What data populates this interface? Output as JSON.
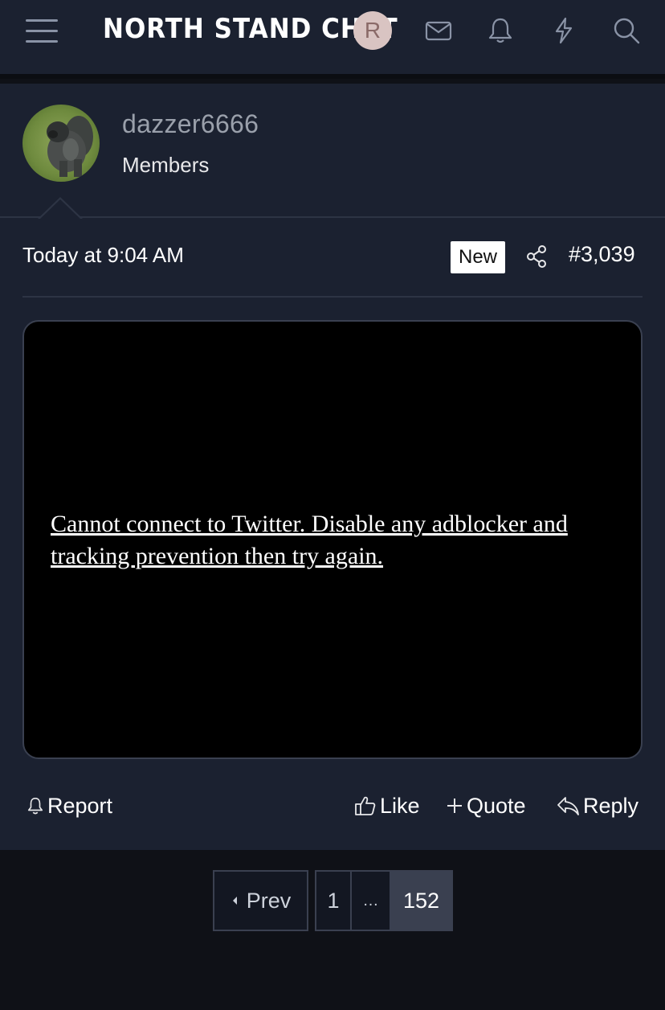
{
  "header": {
    "site_title": "NORTH STAND CHAT",
    "user_initial": "R",
    "icons": [
      "menu-icon",
      "inbox-icon",
      "bell-icon",
      "lightning-icon",
      "search-icon"
    ]
  },
  "post": {
    "username": "dazzer6666",
    "user_title": "Members",
    "date": "Today at 9:04 AM",
    "badge": "New",
    "post_number": "#3,039",
    "embed_message": "Cannot connect to Twitter. Disable any adblocker and tracking prevention then try again.",
    "actions": {
      "report": "Report",
      "like": "Like",
      "quote": "Quote",
      "reply": "Reply"
    }
  },
  "pagination": {
    "prev": "Prev",
    "first": "1",
    "ellipsis": "…",
    "current": "152"
  },
  "colors": {
    "header_bg": "#1b2130",
    "page_bg": "#0f1117",
    "embed_bg": "#000000",
    "badge_bg": "#ffffff"
  }
}
